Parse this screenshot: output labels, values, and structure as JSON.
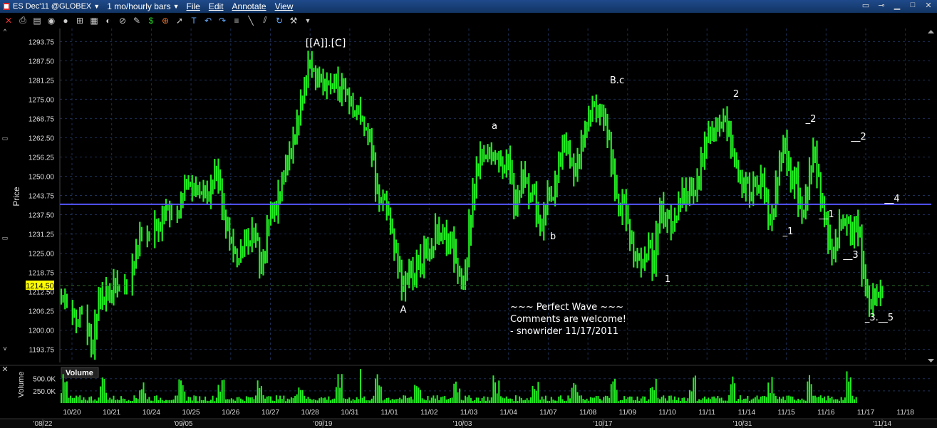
{
  "titlebar": {
    "symbol": "ES Dec'11 @GLOBEX",
    "period": "1 mo/hourly bars",
    "menus": [
      "File",
      "Edit",
      "Annotate",
      "View"
    ]
  },
  "toolbar": {
    "icons": [
      "close-icon",
      "print-icon",
      "new-window-icon",
      "camera-icon",
      "settings-icon",
      "crosshair-icon",
      "calculator-icon",
      "chart-type-icon",
      "record-icon",
      "pencil-icon",
      "currency-icon",
      "target-icon",
      "pointer-icon",
      "text-icon",
      "undo-icon",
      "redo-icon",
      "ruler-icon",
      "trendline-icon",
      "fibonacci-icon",
      "refresh-icon",
      "wrench-icon",
      "dropdown-icon"
    ]
  },
  "chart_data": {
    "type": "bar",
    "price_axis": {
      "label": "Price",
      "ticks": [
        "1293.75",
        "1287.50",
        "1281.25",
        "1275.00",
        "1268.75",
        "1262.50",
        "1256.25",
        "1250.00",
        "1243.75",
        "1237.50",
        "1231.25",
        "1225.00",
        "1218.75",
        "1212.50",
        "1206.25",
        "1200.00",
        "1193.75"
      ],
      "tick_values": [
        1293.75,
        1287.5,
        1281.25,
        1275,
        1268.75,
        1262.5,
        1256.25,
        1250,
        1243.75,
        1237.5,
        1231.25,
        1225,
        1218.75,
        1212.5,
        1206.25,
        1200,
        1193.75
      ],
      "range": [
        1189.5,
        1298.0
      ],
      "current_price": "1214.50",
      "current_value": 1214.5
    },
    "horizontal_line": 1240.9,
    "x_ticks": [
      "10/20",
      "10/21",
      "10/24",
      "10/25",
      "10/26",
      "10/27",
      "10/28",
      "10/31",
      "11/01",
      "11/02",
      "11/03",
      "11/04",
      "11/07",
      "11/08",
      "11/09",
      "11/10",
      "11/11",
      "11/14",
      "11/15",
      "11/16",
      "11/17",
      "11/18"
    ],
    "overview_ticks": [
      "'08/22",
      "'09/05",
      "'09/19",
      "'10/03",
      "'10/17",
      "'10/31",
      "'11/14"
    ],
    "close_path": [
      [
        0,
        1211
      ],
      [
        1,
        1208
      ],
      [
        3,
        1205
      ],
      [
        4,
        1202
      ],
      [
        5,
        1206
      ],
      [
        7,
        1199
      ],
      [
        8,
        1193
      ],
      [
        9,
        1205
      ],
      [
        10,
        1212
      ],
      [
        11,
        1209
      ],
      [
        12,
        1214
      ],
      [
        13,
        1210
      ],
      [
        14,
        1216
      ],
      [
        15,
        1213
      ],
      [
        17,
        1215
      ],
      [
        19,
        1221
      ],
      [
        20,
        1227
      ],
      [
        21,
        1233
      ],
      [
        23,
        1229
      ],
      [
        25,
        1235
      ],
      [
        26,
        1232
      ],
      [
        27,
        1239
      ],
      [
        28,
        1241
      ],
      [
        29,
        1236
      ],
      [
        31,
        1238
      ],
      [
        32,
        1243
      ],
      [
        33,
        1249
      ],
      [
        34,
        1248
      ],
      [
        35,
        1245
      ],
      [
        36,
        1247
      ],
      [
        37,
        1244
      ],
      [
        38,
        1246
      ],
      [
        39,
        1243
      ],
      [
        40,
        1248
      ],
      [
        41,
        1252
      ],
      [
        42,
        1247
      ],
      [
        43,
        1237
      ],
      [
        44,
        1233
      ],
      [
        45,
        1229
      ],
      [
        46,
        1225
      ],
      [
        47,
        1223
      ],
      [
        48,
        1227
      ],
      [
        49,
        1231
      ],
      [
        50,
        1228
      ],
      [
        51,
        1233
      ],
      [
        52,
        1229
      ],
      [
        53,
        1220
      ],
      [
        54,
        1225
      ],
      [
        55,
        1236
      ],
      [
        56,
        1240
      ],
      [
        57,
        1238
      ],
      [
        58,
        1245
      ],
      [
        59,
        1250
      ],
      [
        60,
        1255
      ],
      [
        61,
        1258
      ],
      [
        62,
        1263
      ],
      [
        63,
        1269
      ],
      [
        64,
        1275
      ],
      [
        65,
        1281
      ],
      [
        66,
        1287
      ],
      [
        67,
        1284
      ],
      [
        68,
        1280
      ],
      [
        69,
        1283
      ],
      [
        70,
        1278
      ],
      [
        71,
        1281
      ],
      [
        72,
        1279
      ],
      [
        73,
        1282
      ],
      [
        74,
        1276
      ],
      [
        75,
        1280
      ],
      [
        76,
        1277
      ],
      [
        77,
        1274
      ],
      [
        78,
        1270
      ],
      [
        79,
        1272
      ],
      [
        80,
        1268
      ],
      [
        81,
        1265
      ],
      [
        82,
        1262
      ],
      [
        83,
        1256
      ],
      [
        84,
        1245
      ],
      [
        85,
        1242
      ],
      [
        86,
        1244
      ],
      [
        87,
        1238
      ],
      [
        88,
        1232
      ],
      [
        89,
        1225
      ],
      [
        90,
        1219
      ],
      [
        91,
        1213
      ],
      [
        92,
        1217
      ],
      [
        93,
        1221
      ],
      [
        94,
        1215
      ],
      [
        95,
        1224
      ],
      [
        96,
        1220
      ],
      [
        97,
        1229
      ],
      [
        98,
        1224
      ],
      [
        99,
        1227
      ],
      [
        100,
        1234
      ],
      [
        101,
        1229
      ],
      [
        102,
        1232
      ],
      [
        103,
        1226
      ],
      [
        104,
        1231
      ],
      [
        105,
        1222
      ],
      [
        106,
        1218
      ],
      [
        107,
        1215
      ],
      [
        108,
        1222
      ],
      [
        109,
        1236
      ],
      [
        110,
        1246
      ],
      [
        111,
        1253
      ],
      [
        112,
        1258
      ],
      [
        113,
        1256
      ],
      [
        114,
        1259
      ],
      [
        115,
        1255
      ],
      [
        116,
        1257
      ],
      [
        117,
        1254
      ],
      [
        118,
        1252
      ],
      [
        119,
        1257
      ],
      [
        120,
        1249
      ],
      [
        121,
        1239
      ],
      [
        122,
        1244
      ],
      [
        123,
        1251
      ],
      [
        124,
        1248
      ],
      [
        125,
        1243
      ],
      [
        126,
        1246
      ],
      [
        127,
        1236
      ],
      [
        128,
        1232
      ],
      [
        129,
        1240
      ],
      [
        130,
        1245
      ],
      [
        131,
        1243
      ],
      [
        132,
        1250
      ],
      [
        133,
        1256
      ],
      [
        134,
        1262
      ],
      [
        135,
        1258
      ],
      [
        136,
        1254
      ],
      [
        137,
        1250
      ],
      [
        138,
        1256
      ],
      [
        139,
        1262
      ],
      [
        140,
        1266
      ],
      [
        141,
        1271
      ],
      [
        142,
        1273
      ],
      [
        143,
        1270
      ],
      [
        144,
        1272
      ],
      [
        145,
        1268
      ],
      [
        146,
        1262
      ],
      [
        147,
        1252
      ],
      [
        148,
        1243
      ],
      [
        149,
        1238
      ],
      [
        150,
        1244
      ],
      [
        151,
        1235
      ],
      [
        152,
        1229
      ],
      [
        153,
        1223
      ],
      [
        154,
        1225
      ],
      [
        155,
        1221
      ],
      [
        156,
        1224
      ],
      [
        157,
        1228
      ],
      [
        158,
        1219
      ],
      [
        159,
        1233
      ],
      [
        160,
        1241
      ],
      [
        161,
        1234
      ],
      [
        162,
        1238
      ],
      [
        163,
        1233
      ],
      [
        164,
        1237
      ],
      [
        165,
        1242
      ],
      [
        166,
        1246
      ],
      [
        167,
        1242
      ],
      [
        168,
        1248
      ],
      [
        169,
        1244
      ],
      [
        170,
        1249
      ],
      [
        171,
        1256
      ],
      [
        172,
        1262
      ],
      [
        173,
        1265
      ],
      [
        174,
        1263
      ],
      [
        175,
        1268
      ],
      [
        176,
        1266
      ],
      [
        177,
        1269
      ],
      [
        178,
        1264
      ],
      [
        179,
        1258
      ],
      [
        180,
        1254
      ],
      [
        181,
        1249
      ],
      [
        182,
        1245
      ],
      [
        183,
        1248
      ],
      [
        184,
        1243
      ],
      [
        185,
        1249
      ],
      [
        186,
        1246
      ],
      [
        187,
        1250
      ],
      [
        188,
        1242
      ],
      [
        189,
        1234
      ],
      [
        190,
        1238
      ],
      [
        191,
        1248
      ],
      [
        192,
        1256
      ],
      [
        193,
        1262
      ],
      [
        194,
        1253
      ],
      [
        195,
        1246
      ],
      [
        196,
        1251
      ],
      [
        197,
        1240
      ],
      [
        198,
        1237
      ],
      [
        199,
        1245
      ],
      [
        200,
        1253
      ],
      [
        201,
        1259
      ],
      [
        202,
        1250
      ],
      [
        203,
        1240
      ],
      [
        204,
        1236
      ],
      [
        205,
        1228
      ],
      [
        206,
        1224
      ],
      [
        207,
        1229
      ],
      [
        208,
        1236
      ],
      [
        209,
        1234
      ],
      [
        210,
        1236
      ],
      [
        211,
        1229
      ],
      [
        212,
        1236
      ],
      [
        213,
        1231
      ],
      [
        214,
        1218
      ],
      [
        215,
        1212
      ],
      [
        216,
        1208
      ],
      [
        217,
        1212
      ],
      [
        218,
        1211
      ],
      [
        219,
        1213
      ]
    ],
    "annotations": [
      {
        "text": "[[A]].[C]"
      },
      {
        "text": "a"
      },
      {
        "text": "b"
      },
      {
        "text": "B.c"
      },
      {
        "text": "A"
      },
      {
        "text": "1"
      },
      {
        "text": "2"
      },
      {
        "text": "_2"
      },
      {
        "text": "__2"
      },
      {
        "text": "_1"
      },
      {
        "text": "__1"
      },
      {
        "text": "__3"
      },
      {
        "text": "__4"
      },
      {
        "text": "_3.__5"
      }
    ],
    "comment_lines": [
      "~~~ Perfect Wave ~~~",
      "Comments are welcome!",
      "- snowrider  11/17/2011"
    ]
  },
  "volume_panel": {
    "title": "Volume",
    "axis_label": "Volume",
    "ticks": [
      "500.0K",
      "250.0K"
    ],
    "tick_values": [
      500000,
      250000
    ],
    "max": 700000
  },
  "colors": {
    "background": "#000000",
    "bars": "#22ee22",
    "hline": "#5555ff",
    "grid": "#1c2f55",
    "price_tag": "#ffff00",
    "title_bar": "#1a3f7a"
  }
}
